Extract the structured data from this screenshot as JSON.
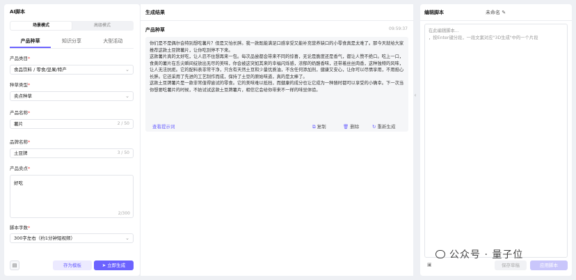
{
  "left": {
    "title": "AI脚本",
    "modes": [
      "场景模式",
      "高级模式"
    ],
    "tabs": [
      "产品种草",
      "知识分享",
      "大型活动"
    ],
    "category": {
      "label": "产品类目",
      "value": "食品饮料 / 零食/坚果/特产"
    },
    "seed_type": {
      "label": "种草类型",
      "value": "卖点种草"
    },
    "product_name": {
      "label": "产品名称",
      "value": "薯片",
      "count": "2 / 50"
    },
    "brand_name": {
      "label": "品牌名称",
      "value": "土豆牌",
      "count": "3 / 50"
    },
    "selling_points": {
      "label": "产品卖点",
      "value": "好吃",
      "count": "2/300"
    },
    "word_count": {
      "label": "脚本字数",
      "value": "300字左右（约1分钟短视频）"
    },
    "save_template": "存为模板",
    "generate": "立即生成"
  },
  "mid": {
    "title": "生成结果",
    "card_title": "产品种草",
    "time": "09:59:37",
    "content": "你们是不是偶尔会特别想吃薯片？但是又怕长胖。我一款既能满足口感享受又能补充营养缺口的小零食真是太难了。那今天就给大家推荐这款土豆牌薯片，让你吃到停不下来。\n这款薯片真的太好吃，让人忍不住想再来一包。每次品尝都会带来不同的惊喜，无论是脆度还是香气，都让人赞不绝口。吃上一口，食黄的薯片在舌尖瞬间绽放出无尽的美味，你会被这突如其来的幸福闪烁感，浓郁的奶酪香味，还带着丝丝肉香，这种独特的风味，让人无法抗拒。它的配料表非常干净，只含有天然土豆和少量优质油，不含任何添加剂，健康又安心，让你可以尽情享用，不用担心长胖。它还采用了先进的工艺制作而成，保持了土豆的原始味道，真的是太棒了。\n这款土豆牌薯片是一款非常值得尝试的零食。它的美味难以抵挡，而健康的成分也让它成为一种随时都可以享受的小确幸。下一次当你想要吃薯片的时候，不妨试试这款土豆牌薯片，相信它会给你带来不一样的味觉体验。",
    "hint": "查看提示词",
    "copy": "复制",
    "delete": "删除",
    "regenerate": "重新生成"
  },
  "right": {
    "title": "编辑脚本",
    "name": "未命名",
    "placeholder_1": "在此编辑脚本...",
    "placeholder_2": "，按Enter键分段，一段文案对应\"3D生成\"中的一个片段",
    "save_script": "保存草稿",
    "use_script": "应用脚本"
  },
  "watermark": "公众号 · 量子位"
}
